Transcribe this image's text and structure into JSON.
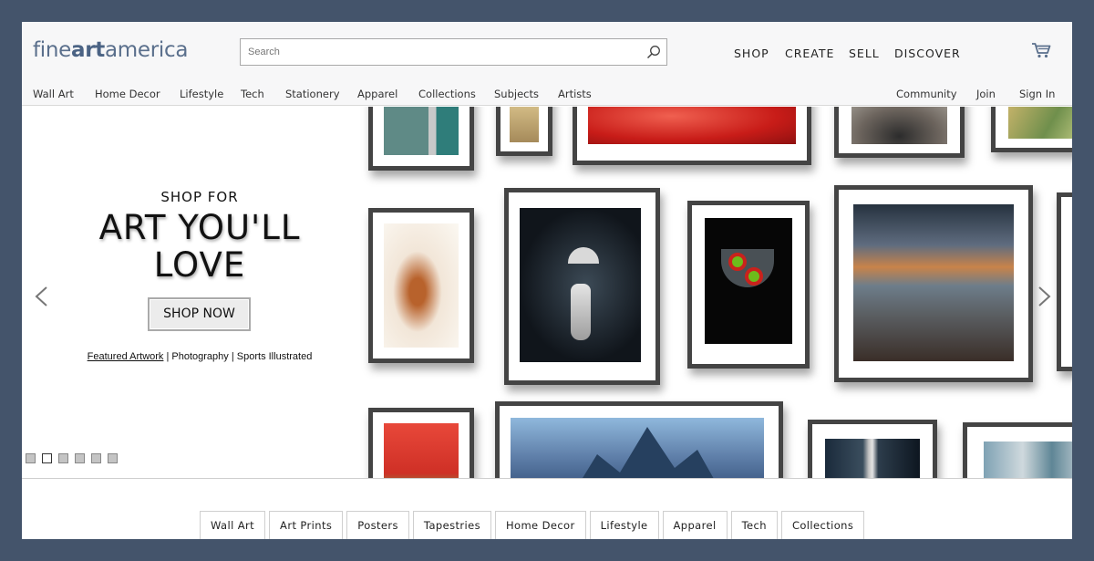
{
  "brand": {
    "logo_part1": "fine",
    "logo_part2": "art",
    "logo_part3": "america"
  },
  "search": {
    "placeholder": "Search",
    "value": ""
  },
  "top_nav": [
    "SHOP",
    "CREATE",
    "SELL",
    "DISCOVER"
  ],
  "sub_nav_left": [
    "Wall Art",
    "Home Decor",
    "Lifestyle",
    "Tech",
    "Stationery",
    "Apparel",
    "Collections",
    "Subjects",
    "Artists"
  ],
  "sub_nav_right": [
    "Community",
    "Join",
    "Sign In"
  ],
  "hero": {
    "kicker": "SHOP FOR",
    "headline_line1": "ART YOU'LL",
    "headline_line2": "LOVE",
    "cta": "SHOP NOW",
    "links": [
      "Featured Artwork",
      "Photography",
      "Sports Illustrated"
    ],
    "link_separator": "|",
    "slide_count": 6,
    "active_slide": 2
  },
  "categories": [
    "Wall Art",
    "Art Prints",
    "Posters",
    "Tapestries",
    "Home Decor",
    "Lifestyle",
    "Apparel",
    "Tech",
    "Collections"
  ],
  "icons": {
    "search": "search-icon",
    "cart": "cart-icon",
    "prev": "chevron-left-icon",
    "next": "chevron-right-icon"
  },
  "colors": {
    "page_background": "#44546b",
    "brand_blue": "#5a6f8c",
    "frame": "#444444"
  }
}
